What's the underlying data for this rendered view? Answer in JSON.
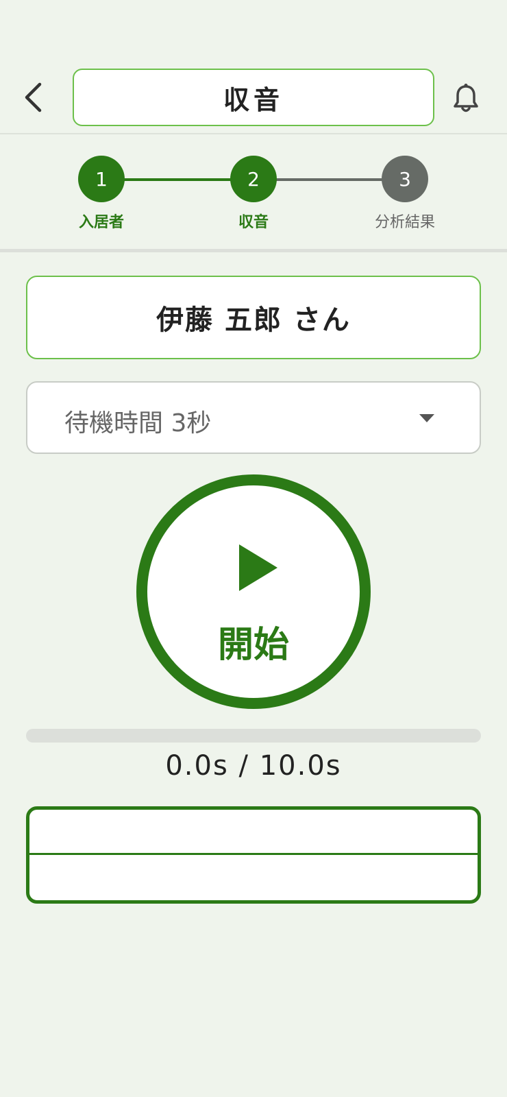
{
  "header": {
    "title": "収音",
    "back_icon": "chevron-left-icon",
    "bell_icon": "bell-icon"
  },
  "stepper": {
    "steps": [
      {
        "number": "1",
        "label": "入居者",
        "state": "done"
      },
      {
        "number": "2",
        "label": "収音",
        "state": "active"
      },
      {
        "number": "3",
        "label": "分析結果",
        "state": "pending"
      }
    ],
    "colors": {
      "active": "#2b7a16",
      "pending": "#666b66"
    }
  },
  "resident": {
    "name": "伊藤 五郎 さん"
  },
  "wait_select": {
    "selected": "待機時間 3秒"
  },
  "start_button": {
    "label": "開始",
    "icon": "play-icon"
  },
  "recording": {
    "progress": 0.0,
    "time_text": "0.0s / 10.0s"
  },
  "theme": {
    "primary": "#2b7a16",
    "accent_border": "#6cc04a",
    "background": "#eff4ec"
  }
}
